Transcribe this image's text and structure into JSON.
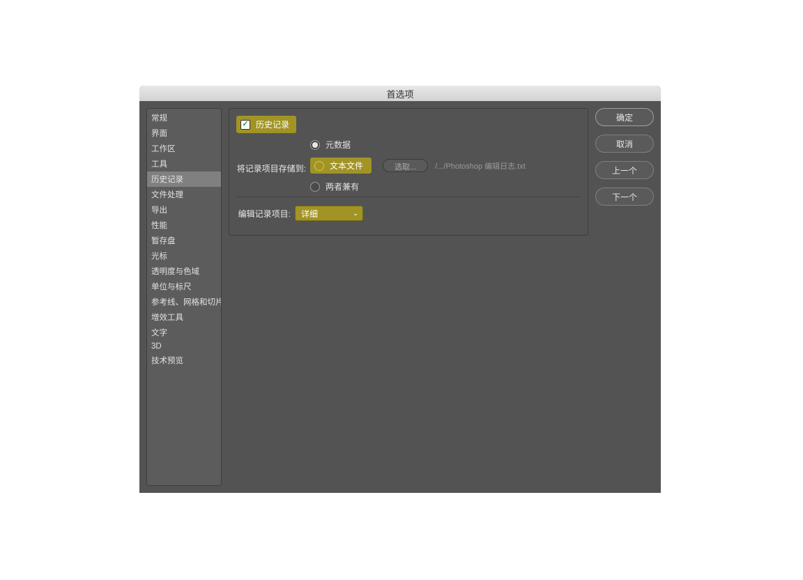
{
  "dialog": {
    "title": "首选项"
  },
  "sidebar": {
    "items": [
      {
        "label": "常规"
      },
      {
        "label": "界面"
      },
      {
        "label": "工作区"
      },
      {
        "label": "工具"
      },
      {
        "label": "历史记录",
        "selected": true
      },
      {
        "label": "文件处理"
      },
      {
        "label": "导出"
      },
      {
        "label": "性能"
      },
      {
        "label": "暂存盘"
      },
      {
        "label": "光标"
      },
      {
        "label": "透明度与色域"
      },
      {
        "label": "单位与标尺"
      },
      {
        "label": "参考线、网格和切片"
      },
      {
        "label": "增效工具"
      },
      {
        "label": "文字"
      },
      {
        "label": "3D"
      },
      {
        "label": "技术预览"
      }
    ]
  },
  "main": {
    "history_log_checkbox": {
      "label": "历史记录",
      "checked": true
    },
    "save_to_label": "将记录项目存储到:",
    "radios": {
      "metadata": "元数据",
      "textfile": "文本文件",
      "both": "两者兼有",
      "selected": "metadata"
    },
    "choose_button": "选取...",
    "path_text": "/.../Photoshop 编辑日志.txt",
    "edit_items_label": "编辑记录项目:",
    "edit_items_value": "详细"
  },
  "buttons": {
    "ok": "确定",
    "cancel": "取消",
    "prev": "上一个",
    "next": "下一个"
  }
}
